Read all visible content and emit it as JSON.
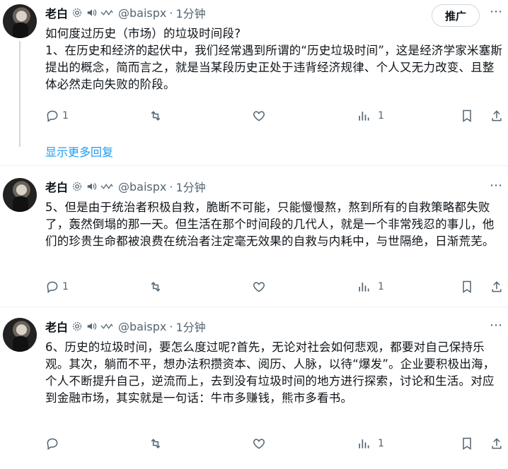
{
  "tweets": [
    {
      "name": "老白",
      "handle": "@baispx",
      "sep": "·",
      "time": "1分钟",
      "promo_label": "推广",
      "text": "如何度过历史（市场）的垃圾时间段?\n1、在历史和经济的起伏中，我们经常遇到所谓的“历史垃圾时间”，这是经济学家米塞斯提出的概念，简而言之，就是当某段历史正处于违背经济规律、个人又无力改变、且整体必然走向失败的阶段。",
      "reply_count": "1",
      "retweet_count": "",
      "like_count": "",
      "view_count": "1"
    },
    {
      "name": "老白",
      "handle": "@baispx",
      "sep": "·",
      "time": "1分钟",
      "text": "5、但是由于统治者积极自救，脆断不可能，只能慢慢熬，熬到所有的自救策略都失败了，轰然倒塌的那一天。但生活在那个时间段的几代人，就是一个非常残忍的事儿，他们的珍贵生命都被浪费在统治者注定毫无效果的自救与内耗中，与世隔绝，日渐荒芜。",
      "reply_count": "1",
      "view_count": "1"
    },
    {
      "name": "老白",
      "handle": "@baispx",
      "sep": "·",
      "time": "1分钟",
      "text": "6、历史的垃圾时间，要怎么度过呢?首先，无论对社会如何悲观，都要对自己保持乐观。其次，躺而不平，想办法积攒资本、阅历、人脉，以待“爆发”。企业要积极出海，个人不断提升自己，逆流而上，去到没有垃圾时间的地方进行探索，讨论和生活。对应到金融市场，其实就是一句话：牛市多赚钱，熊市多看书。",
      "reply_count": "",
      "view_count": "1"
    }
  ],
  "show_more_replies": "显示更多回复",
  "icons": [
    "settings-icon",
    "speaker-icon",
    "wave-icon",
    "reply-icon",
    "retweet-icon",
    "like-icon",
    "views-icon",
    "bookmark-icon"
  ],
  "colors": {
    "link": "#1d9bf0",
    "muted": "#536471",
    "text": "#0f1419"
  }
}
